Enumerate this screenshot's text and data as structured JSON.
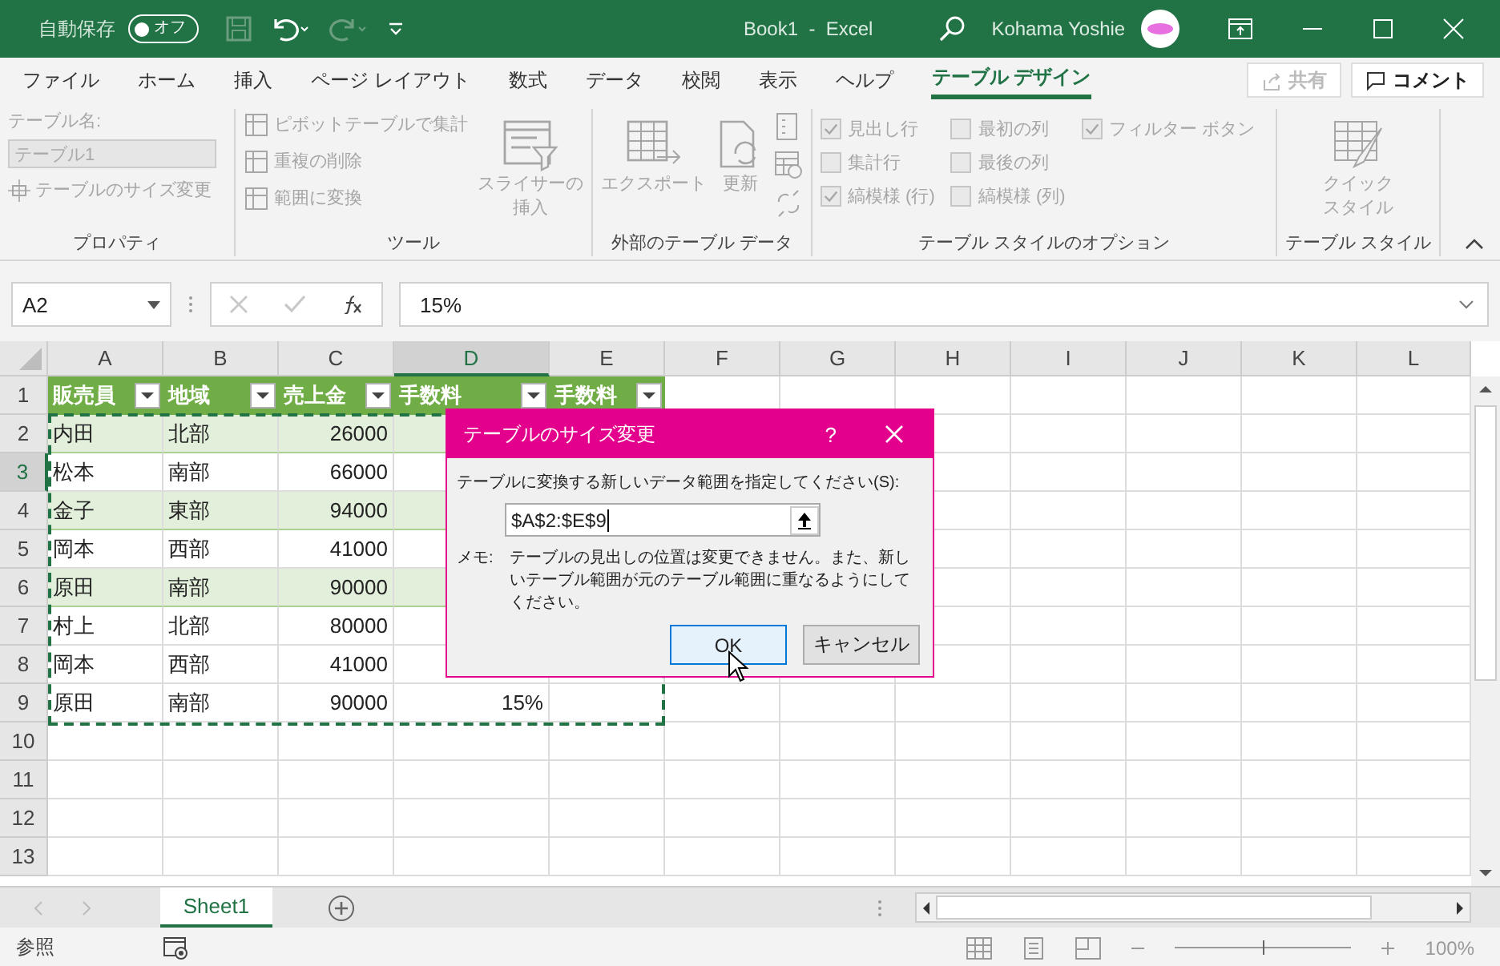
{
  "title_bar": {
    "autosave_label": "自動保存",
    "autosave": {
      "label": "オフ",
      "on": false
    },
    "title": "Book1  -  Excel",
    "user": "Kohama Yoshie"
  },
  "menu_tabs": [
    {
      "label": "ファイル",
      "selected": false
    },
    {
      "label": "ホーム",
      "selected": false
    },
    {
      "label": "挿入",
      "selected": false
    },
    {
      "label": "ページ レイアウト",
      "selected": false
    },
    {
      "label": "数式",
      "selected": false
    },
    {
      "label": "データ",
      "selected": false
    },
    {
      "label": "校閲",
      "selected": false
    },
    {
      "label": "表示",
      "selected": false
    },
    {
      "label": "ヘルプ",
      "selected": false
    },
    {
      "label": "テーブル デザイン",
      "selected": true
    }
  ],
  "share_button": {
    "label": "共有",
    "disabled": true
  },
  "comment_button": {
    "label": "コメント"
  },
  "ribbon": {
    "disabled": true,
    "properties": {
      "group_label": "プロパティ",
      "name_label": "テーブル名:",
      "name_value": "テーブル1",
      "resize_button": "テーブルのサイズ変更"
    },
    "tools": {
      "group_label": "ツール",
      "buttons": [
        "ピボットテーブルで集計",
        "重複の削除",
        "範囲に変換"
      ],
      "slicer_lines": [
        "スライサーの",
        "挿入"
      ]
    },
    "external": {
      "group_label": "外部のテーブル データ",
      "export_button": "エクスポート",
      "refresh_button": "更新"
    },
    "style_options": {
      "group_label": "テーブル スタイルのオプション",
      "checkboxes": [
        {
          "label": "見出し行",
          "checked": true
        },
        {
          "label": "集計行",
          "checked": false
        },
        {
          "label": "縞模様 (行)",
          "checked": true
        },
        {
          "label": "最初の列",
          "checked": false
        },
        {
          "label": "最後の列",
          "checked": false
        },
        {
          "label": "縞模様 (列)",
          "checked": false
        },
        {
          "label": "フィルター ボタン",
          "checked": true
        }
      ]
    },
    "table_styles": {
      "group_label": "テーブル スタイル",
      "quick_style_lines": [
        "クイック",
        "スタイル"
      ]
    }
  },
  "formula_bar": {
    "name_box": "A2",
    "value": "15%"
  },
  "sheet": {
    "columns": [
      {
        "label": "A",
        "selected": false
      },
      {
        "label": "B",
        "selected": false
      },
      {
        "label": "C",
        "selected": false
      },
      {
        "label": "D",
        "selected": true
      },
      {
        "label": "E",
        "selected": false
      },
      {
        "label": "F",
        "selected": false
      },
      {
        "label": "G",
        "selected": false
      },
      {
        "label": "H",
        "selected": false
      },
      {
        "label": "I",
        "selected": false
      },
      {
        "label": "J",
        "selected": false
      },
      {
        "label": "K",
        "selected": false
      },
      {
        "label": "L",
        "selected": false
      }
    ],
    "header_row": {
      "number": "1",
      "selected": false,
      "cells": [
        "販売員",
        "地域",
        "売上金",
        "手数料",
        "手数料"
      ]
    },
    "rows": [
      {
        "number": "2",
        "selected": false,
        "shaded": true,
        "cells": [
          "内田",
          "北部",
          "26000"
        ]
      },
      {
        "number": "3",
        "selected": true,
        "shaded": false,
        "cells": [
          "松本",
          "南部",
          "66000"
        ]
      },
      {
        "number": "4",
        "selected": false,
        "shaded": true,
        "cells": [
          "金子",
          "東部",
          "94000"
        ]
      },
      {
        "number": "5",
        "selected": false,
        "shaded": false,
        "cells": [
          "岡本",
          "西部",
          "41000"
        ]
      },
      {
        "number": "6",
        "selected": false,
        "shaded": true,
        "cells": [
          "原田",
          "南部",
          "90000"
        ]
      },
      {
        "number": "7",
        "selected": false,
        "shaded": false,
        "cells": [
          "村上",
          "北部",
          "80000"
        ]
      },
      {
        "number": "8",
        "selected": false,
        "shaded": false,
        "cells": [
          "岡本",
          "西部",
          "41000"
        ]
      },
      {
        "number": "9",
        "selected": false,
        "shaded": false,
        "cells": [
          "原田",
          "南部",
          "90000",
          "15%"
        ]
      },
      {
        "number": "10",
        "selected": false,
        "shaded": false,
        "cells": []
      },
      {
        "number": "11",
        "selected": false,
        "shaded": false,
        "cells": []
      },
      {
        "number": "12",
        "selected": false,
        "shaded": false,
        "cells": []
      },
      {
        "number": "13",
        "selected": false,
        "shaded": false,
        "cells": []
      }
    ]
  },
  "dialog": {
    "title": "テーブルのサイズ変更",
    "help": "?",
    "prompt": "テーブルに変換する新しいデータ範囲を指定してください(S):",
    "range_value": "$A$2:$E$9",
    "note_label": "メモ:",
    "note": "テーブルの見出しの位置は変更できません。また、新しいテーブル範囲が元のテーブル範囲に重なるようにしてください。",
    "ok_button": "OK",
    "cancel_button": "キャンセル"
  },
  "sheet_tabs": [
    {
      "label": "Sheet1",
      "selected": true
    }
  ],
  "status_bar": {
    "mode": "参照",
    "zoom_slider": {
      "level": 0.5
    },
    "zoom": "100%"
  }
}
